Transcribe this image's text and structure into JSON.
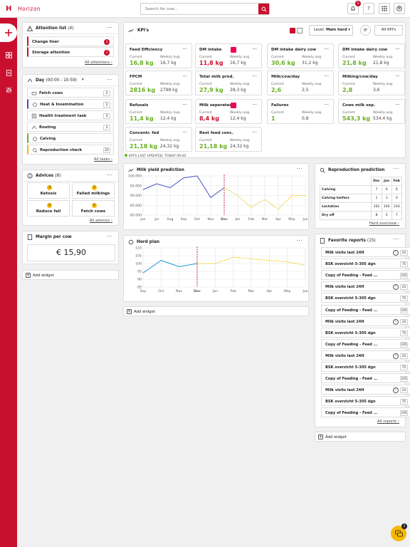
{
  "app": {
    "brand": "Horizon",
    "logo_letter": "H"
  },
  "search": {
    "placeholder": "Search for cow..."
  },
  "topbar": {
    "notification_count": "0",
    "help_icon": "?",
    "colors": {
      "brand": "#c8102e",
      "accent": "#f5b800",
      "positive": "#6ab023"
    }
  },
  "attention": {
    "title": "Attention list",
    "count": "(4)",
    "items": [
      {
        "label": "Change liner",
        "badge": "3"
      },
      {
        "label": "Storage attention",
        "badge": "1"
      }
    ],
    "link": "All attentions"
  },
  "day": {
    "title": "Day",
    "range": "(00:00 - 10:59)",
    "tasks": [
      {
        "label": "Fetch cows",
        "count": "2",
        "icon": "cow-icon"
      },
      {
        "label": "Heat & Insemination",
        "count": "2",
        "icon": "heat-icon"
      },
      {
        "label": "Health treatment task",
        "count": "3",
        "icon": "health-icon"
      },
      {
        "label": "Routing",
        "count": "2",
        "icon": "routing-icon"
      },
      {
        "label": "Calving",
        "count": "",
        "icon": "calving-icon"
      },
      {
        "label": "Reproduction check",
        "count": "22",
        "icon": "reproduction-icon"
      }
    ],
    "link": "All tasks"
  },
  "advices": {
    "title": "Advices",
    "count": "(8)",
    "items": [
      {
        "label": "Ketosis",
        "num": "3"
      },
      {
        "label": "Failed milkings",
        "num": "2"
      },
      {
        "label": "Reduce fail",
        "num": "2"
      },
      {
        "label": "Fetch cows",
        "num": "1"
      }
    ],
    "link": "All advices"
  },
  "margin": {
    "title": "Margin per cow",
    "value": "€ 15,90"
  },
  "add_widget": "Add widget",
  "kpis": {
    "title": "KPI's",
    "level_label": "Level:",
    "level_value": "Main herd",
    "all_label": "All KPI's",
    "current_label": "Current",
    "weekly_label": "Weekly avg.",
    "updated": "KPI'S LAST UPDATED, TODAY 09:45",
    "items": [
      {
        "title": "Feed Efficiency",
        "current": "16,8 kg",
        "weekly": "16,7 kg",
        "alert": false
      },
      {
        "title": "DM intake",
        "current": "11,8 kg",
        "weekly": "16,7 kg",
        "alert": true
      },
      {
        "title": "DM intake dairy cow",
        "current": "30,6 kg",
        "weekly": "31,2 kg",
        "alert": false
      },
      {
        "title": "DM intake dairy cow",
        "current": "21,8 kg",
        "weekly": "21,8 kg",
        "alert": false
      },
      {
        "title": "FPCM",
        "current": "2816 kg",
        "weekly": "2798 kg",
        "alert": false
      },
      {
        "title": "Total milk prod.",
        "current": "27,9 kg",
        "weekly": "28,3 kg",
        "alert": false
      },
      {
        "title": "Milk/cow/day",
        "current": "2,6",
        "weekly": "2,5",
        "alert": false
      },
      {
        "title": "Milking/cow/day",
        "current": "2,8",
        "weekly": "3,6",
        "alert": false
      },
      {
        "title": "Refusals",
        "current": "11,4 kg",
        "weekly": "12,4 kg",
        "alert": false
      },
      {
        "title": "Milk seperated",
        "current": "8,4 kg",
        "weekly": "12,4 kg",
        "alert": true
      },
      {
        "title": "Failures",
        "current": "1",
        "weekly": "0,8",
        "alert": false
      },
      {
        "title": "Cows milk sep.",
        "current": "543,3 kg",
        "weekly": "534,4 kg",
        "alert": false
      },
      {
        "title": "Concentr. fed",
        "current": "21,18 kg",
        "weekly": "24,32 kg",
        "alert": false
      },
      {
        "title": "Rest feed conc.",
        "current": "21,18 kg",
        "weekly": "24,32 kg",
        "alert": false
      }
    ]
  },
  "reproduction": {
    "title": "Reproduction prediction",
    "months": [
      "Dec",
      "Jan",
      "Feb"
    ],
    "rows": [
      {
        "label": "Calving",
        "values": [
          "7",
          "6",
          "6"
        ]
      },
      {
        "label": "Calving heifers",
        "values": [
          "1",
          "1",
          "0"
        ]
      },
      {
        "label": "Lactation",
        "values": [
          "102",
          "104",
          "103"
        ]
      },
      {
        "label": "Dry off",
        "values": [
          "8",
          "5",
          "7"
        ]
      }
    ],
    "link": "Herd overview"
  },
  "favorites": {
    "title": "Favorite reports",
    "count": "(15)",
    "items": [
      {
        "label": "Milk visits last 24H",
        "count": "24",
        "info": true
      },
      {
        "label": "BSK overzicht 5-305 dgn",
        "count": "75",
        "info": false
      },
      {
        "label": "Copy of Feeding - Feed ...",
        "count": "105",
        "info": false
      },
      {
        "label": "Milk visits last 24H",
        "count": "24",
        "info": true
      },
      {
        "label": "BSK overzicht 5-305 dgn",
        "count": "75",
        "info": false
      },
      {
        "label": "Copy of Feeding - Feed ...",
        "count": "105",
        "info": false
      },
      {
        "label": "Milk visits last 24H",
        "count": "24",
        "info": true
      },
      {
        "label": "BSK overzicht 5-305 dgn",
        "count": "75",
        "info": false
      },
      {
        "label": "Copy of Feeding - Feed ...",
        "count": "105",
        "info": false
      },
      {
        "label": "Milk visits last 24H",
        "count": "24",
        "info": true
      },
      {
        "label": "BSK overzicht 5-305 dgn",
        "count": "75",
        "info": false
      },
      {
        "label": "Copy of Feeding - Feed ...",
        "count": "105",
        "info": false
      },
      {
        "label": "Milk visits last 24H",
        "count": "24",
        "info": true
      },
      {
        "label": "BSK overzicht 5-305 dgn",
        "count": "75",
        "info": false
      },
      {
        "label": "Copy of Feeding - Feed ...",
        "count": "105",
        "info": false
      }
    ],
    "link": "All reports"
  },
  "chat": {
    "badge": "2"
  },
  "chart_data": [
    {
      "type": "line",
      "title": "Milk yield prediction",
      "categories": [
        "Jun",
        "Jul",
        "Aug",
        "Sep",
        "Oct",
        "Nov",
        "Dec",
        "Jan",
        "Feb",
        "Mar",
        "Apr",
        "May",
        "Jun"
      ],
      "ylim": [
        80000,
        100000
      ],
      "yticks": [
        "100.000",
        "95.000",
        "90.000",
        "85.000",
        "80.000"
      ],
      "series": [
        {
          "style": "actual",
          "color": "#4b4fc4",
          "values": [
            93000,
            96000,
            94000,
            99000,
            100000,
            89000,
            94000,
            null,
            null,
            null,
            null,
            null,
            null
          ]
        },
        {
          "style": "prediction",
          "color": "#f5c400",
          "values": [
            null,
            null,
            null,
            null,
            null,
            null,
            94000,
            90000,
            84000,
            88000,
            83000,
            90000,
            90000
          ]
        }
      ],
      "current_marker": "Dec"
    },
    {
      "type": "line",
      "title": "Herd plan",
      "categories": [
        "Sep",
        "Oct",
        "Nov",
        "Dec",
        "Jan",
        "Feb",
        "Mar",
        "Apr",
        "May",
        "Jun"
      ],
      "ylim": [
        85,
        110
      ],
      "yticks": [
        "110",
        "105",
        "100",
        "95",
        "90",
        "85"
      ],
      "series": [
        {
          "style": "actual",
          "color": "#1e9ad6",
          "values": [
            94,
            102,
            98,
            100,
            null,
            null,
            null,
            null,
            null,
            null
          ]
        },
        {
          "style": "prediction",
          "color": "#f5c400",
          "values": [
            null,
            null,
            null,
            100,
            100,
            104,
            103,
            102,
            101,
            99
          ]
        }
      ],
      "current_marker": "Dec"
    }
  ]
}
